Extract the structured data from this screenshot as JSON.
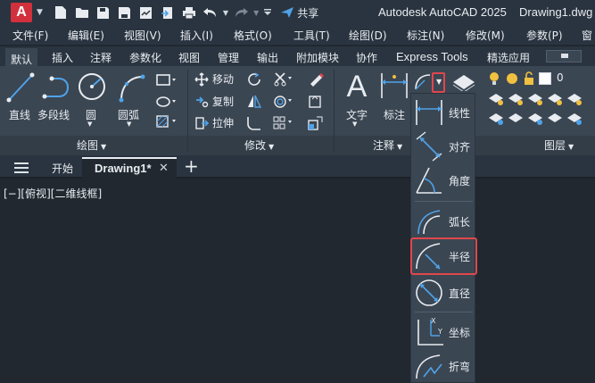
{
  "titlebar": {
    "app_logo": "A",
    "share_label": "共享",
    "app_title": "Autodesk AutoCAD 2025",
    "doc_title": "Drawing1.dwg"
  },
  "menubar": {
    "items": [
      "文件(F)",
      "编辑(E)",
      "视图(V)",
      "插入(I)",
      "格式(O)",
      "工具(T)",
      "绘图(D)",
      "标注(N)",
      "修改(M)",
      "参数(P)",
      "窗"
    ]
  },
  "ribbon_tabs": {
    "items": [
      "默认",
      "插入",
      "注释",
      "参数化",
      "视图",
      "管理",
      "输出",
      "附加模块",
      "协作",
      "Express Tools",
      "精选应用"
    ],
    "active": "默认"
  },
  "draw_panel": {
    "title": "绘图",
    "line": "直线",
    "polyline": "多段线",
    "circle": "圆",
    "arc": "圆弧"
  },
  "modify_panel": {
    "title": "修改",
    "move": "移动",
    "copy": "复制",
    "stretch": "拉伸"
  },
  "annotation_panel": {
    "title": "注释",
    "text": "文字",
    "dimension": "标注"
  },
  "layers_panel": {
    "title": "图层",
    "current_layer": "0"
  },
  "file_tabs": {
    "start": "开始",
    "active": "Drawing1*"
  },
  "viewport_label": "[−][俯视][二维线框]",
  "dimension_dropdown": {
    "items": [
      {
        "label": "线性",
        "icon": "linear-dim-icon"
      },
      {
        "label": "对齐",
        "icon": "aligned-dim-icon"
      },
      {
        "label": "角度",
        "icon": "angular-dim-icon"
      },
      {
        "label": "弧长",
        "icon": "arc-length-dim-icon"
      },
      {
        "label": "半径",
        "icon": "radius-dim-icon"
      },
      {
        "label": "直径",
        "icon": "diameter-dim-icon"
      },
      {
        "label": "坐标",
        "icon": "ordinate-dim-icon"
      },
      {
        "label": "折弯",
        "icon": "jogged-dim-icon"
      }
    ],
    "highlighted": "半径"
  },
  "colors": {
    "accent_highlight": "#e0474c",
    "logo_red": "#d2303c",
    "icon_blue": "#4fa3e8"
  }
}
